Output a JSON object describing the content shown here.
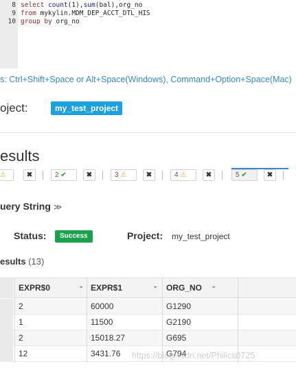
{
  "editor": {
    "lines": [
      {
        "num": "8",
        "parts": [
          {
            "t": "select",
            "c": "kw"
          },
          {
            "t": " ",
            "c": "id"
          },
          {
            "t": "count",
            "c": "fn"
          },
          {
            "t": "(1),",
            "c": "id"
          },
          {
            "t": "sum",
            "c": "fn"
          },
          {
            "t": "(bal),org_no",
            "c": "id"
          }
        ]
      },
      {
        "num": "9",
        "parts": [
          {
            "t": "from",
            "c": "kw"
          },
          {
            "t": " mykylin.MDM_DEP_ACCT_DTL_HIS",
            "c": "id"
          }
        ]
      },
      {
        "num": "10",
        "parts": [
          {
            "t": "group by",
            "c": "kw"
          },
          {
            "t": " org_no",
            "c": "id"
          }
        ]
      }
    ]
  },
  "hint": "s: Ctrl+Shift+Space or Alt+Space(Windows), Command+Option+Space(Mac)",
  "project": {
    "label": "oject:",
    "name": "my_test_project"
  },
  "results_heading": "esults",
  "tabs": [
    {
      "num": "",
      "state": "warn"
    },
    {
      "num": "2",
      "state": "ok"
    },
    {
      "num": "3",
      "state": "warn"
    },
    {
      "num": "4",
      "state": "warn"
    },
    {
      "num": "5",
      "state": "ok",
      "active": true
    }
  ],
  "tab_close_glyph": "✖",
  "query_string": {
    "label": "uery String",
    "chevron": "≫"
  },
  "status": {
    "label": "Status:",
    "value": "Success",
    "color": "#1aa24a"
  },
  "project2": {
    "label": "Project:",
    "value": "my_test_project"
  },
  "results": {
    "label": "esults",
    "count": "(13)"
  },
  "table": {
    "columns": [
      "EXPR$0",
      "EXPR$1",
      "ORG_NO"
    ],
    "sort_glyph": "⌄",
    "rows": [
      [
        "2",
        "60000",
        "G1290"
      ],
      [
        "1",
        "11500",
        "G2190"
      ],
      [
        "2",
        "15018.27",
        "G695"
      ],
      [
        "12",
        "3431.76",
        "G794"
      ]
    ]
  },
  "watermark": "https://blog.csdn.net/Philics0725",
  "colors": {
    "accent": "#1ca1e0",
    "link": "#3a86c8",
    "success": "#1aa24a",
    "ok_check": "#49a84b",
    "warn": "#f0a11c"
  }
}
